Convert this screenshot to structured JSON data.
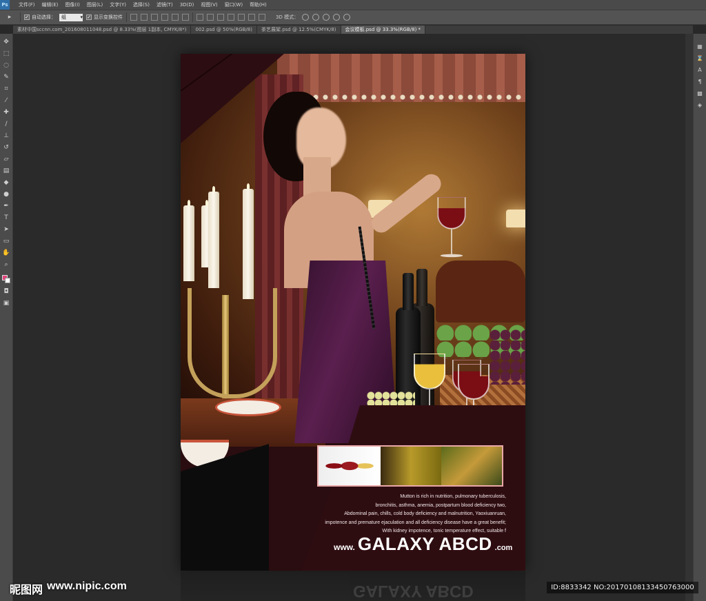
{
  "app": {
    "logo": "Ps"
  },
  "menu": [
    "文件(F)",
    "编辑(E)",
    "图像(I)",
    "图层(L)",
    "文字(Y)",
    "选择(S)",
    "滤镜(T)",
    "3D(D)",
    "视图(V)",
    "窗口(W)",
    "帮助(H)"
  ],
  "options": {
    "auto_select_label": "自动选择：",
    "auto_select_value": "组",
    "show_transform_label": "显示变换控件",
    "mode_3d_label": "3D 模式："
  },
  "tabs": [
    {
      "label": "素材中国sccnn.com_201608011048.psd @ 8.33%(图层 1副本, CMYK/8*)",
      "active": false
    },
    {
      "label": "002.psd @ 50%(RGB/8)",
      "active": false
    },
    {
      "label": "茶艺展架.psd @ 12.5%(CMYK/8)",
      "active": false
    },
    {
      "label": "会议模板.psd @ 33.3%(RGB/8) *",
      "active": true
    }
  ],
  "poster": {
    "body_lines": [
      "Mutton is rich in nutrition, pulmonary tuberculosis,",
      "bronchitis, asthma, anemia, postpartum blood deficiency two,",
      "Abdominal pain, chills, cold body deficiency and malnutrition, Yaoxiuanruan,",
      "impotence and premature ejaculation and all deficiency disease have a great benefit;",
      "With kidney impotence, tonic temperature effect, suitable f"
    ],
    "brand_prefix": "www.",
    "brand_name": "GALAXY ABCD",
    "brand_suffix": ".com"
  },
  "watermark": {
    "site_cn": "昵图网",
    "site_url": "www.nipic.com",
    "id_text": "ID:8833342 NO:20170108133450763000"
  },
  "colors": {
    "accent_pink": "#e2417a",
    "poster_bg": "#2e0d11",
    "thumb_border": "#e9a8a8"
  },
  "icons": {
    "left_tools": [
      "move-icon",
      "marquee-icon",
      "lasso-icon",
      "quick-select-icon",
      "crop-icon",
      "eyedropper-icon",
      "healing-brush-icon",
      "brush-icon",
      "clone-stamp-icon",
      "history-brush-icon",
      "eraser-icon",
      "gradient-icon",
      "blur-icon",
      "dodge-icon",
      "pen-icon",
      "type-icon",
      "path-select-icon",
      "shape-icon",
      "hand-icon",
      "zoom-icon"
    ],
    "right_panels": [
      "layers-icon",
      "history-icon",
      "character-icon",
      "paragraph-icon",
      "swatches-icon",
      "cube-icon"
    ]
  }
}
